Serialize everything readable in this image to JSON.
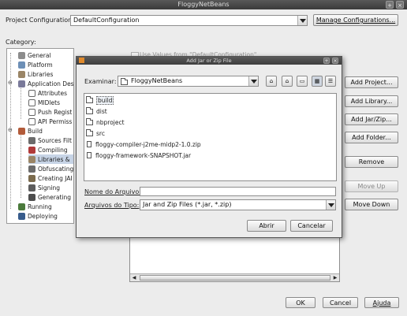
{
  "window": {
    "title": "FloggyNetBeans"
  },
  "project_config": {
    "label": "Project Configuration:",
    "value": "DefaultConfiguration",
    "manage_button": "Manage Configurations..."
  },
  "category": {
    "label": "Category:",
    "items": [
      {
        "label": "General",
        "icon": "general-icon"
      },
      {
        "label": "Platform",
        "icon": "platform-icon"
      },
      {
        "label": "Libraries",
        "icon": "libraries-icon"
      },
      {
        "label": "Application Des",
        "icon": "app-descriptor-icon"
      },
      {
        "label": "Attributes",
        "icon": "page-icon"
      },
      {
        "label": "MIDlets",
        "icon": "page-icon"
      },
      {
        "label": "Push Regist",
        "icon": "page-icon"
      },
      {
        "label": "API Permiss",
        "icon": "page-icon"
      },
      {
        "label": "Build",
        "icon": "build-icon"
      },
      {
        "label": "Sources Filt",
        "icon": "filter-icon"
      },
      {
        "label": "Compiling",
        "icon": "compile-icon"
      },
      {
        "label": "Libraries &",
        "icon": "libraries-icon"
      },
      {
        "label": "Obfuscating",
        "icon": "obfuscate-icon"
      },
      {
        "label": "Creating JAI",
        "icon": "jar-icon"
      },
      {
        "label": "Signing",
        "icon": "signing-icon"
      },
      {
        "label": "Generating",
        "icon": "javadoc-icon"
      },
      {
        "label": "Running",
        "icon": "run-icon"
      },
      {
        "label": "Deploying",
        "icon": "deploy-icon"
      }
    ]
  },
  "use_values": {
    "label": "Use Values from \"DefaultConfiguration\""
  },
  "right_buttons": {
    "add_project": "Add Project...",
    "add_library": "Add Library...",
    "add_jar": "Add Jar/Zip...",
    "add_folder": "Add Folder...",
    "remove": "Remove",
    "move_up": "Move Up",
    "move_down": "Move Down"
  },
  "bottom_buttons": {
    "ok": "OK",
    "cancel": "Cancel",
    "help": "Ajuda"
  },
  "dialog": {
    "title": "Add Jar or Zip File",
    "look_in_label": "Examinar:",
    "look_in_value": "FloggyNetBeans",
    "files": [
      {
        "name": "build",
        "type": "folder"
      },
      {
        "name": "dist",
        "type": "folder"
      },
      {
        "name": "nbproject",
        "type": "folder"
      },
      {
        "name": "src",
        "type": "folder"
      },
      {
        "name": "floggy-compiler-j2me-midp2-1.0.zip",
        "type": "file"
      },
      {
        "name": "floggy-framework-SNAPSHOT.jar",
        "type": "file"
      }
    ],
    "filename_label": "Nome do Arquivo:",
    "filename_value": "",
    "filetype_label": "Arquivos do Tipo:",
    "filetype_value": "Jar and Zip Files (*.jar, *.zip)",
    "open_button": "Abrir",
    "cancel_button": "Cancelar"
  }
}
